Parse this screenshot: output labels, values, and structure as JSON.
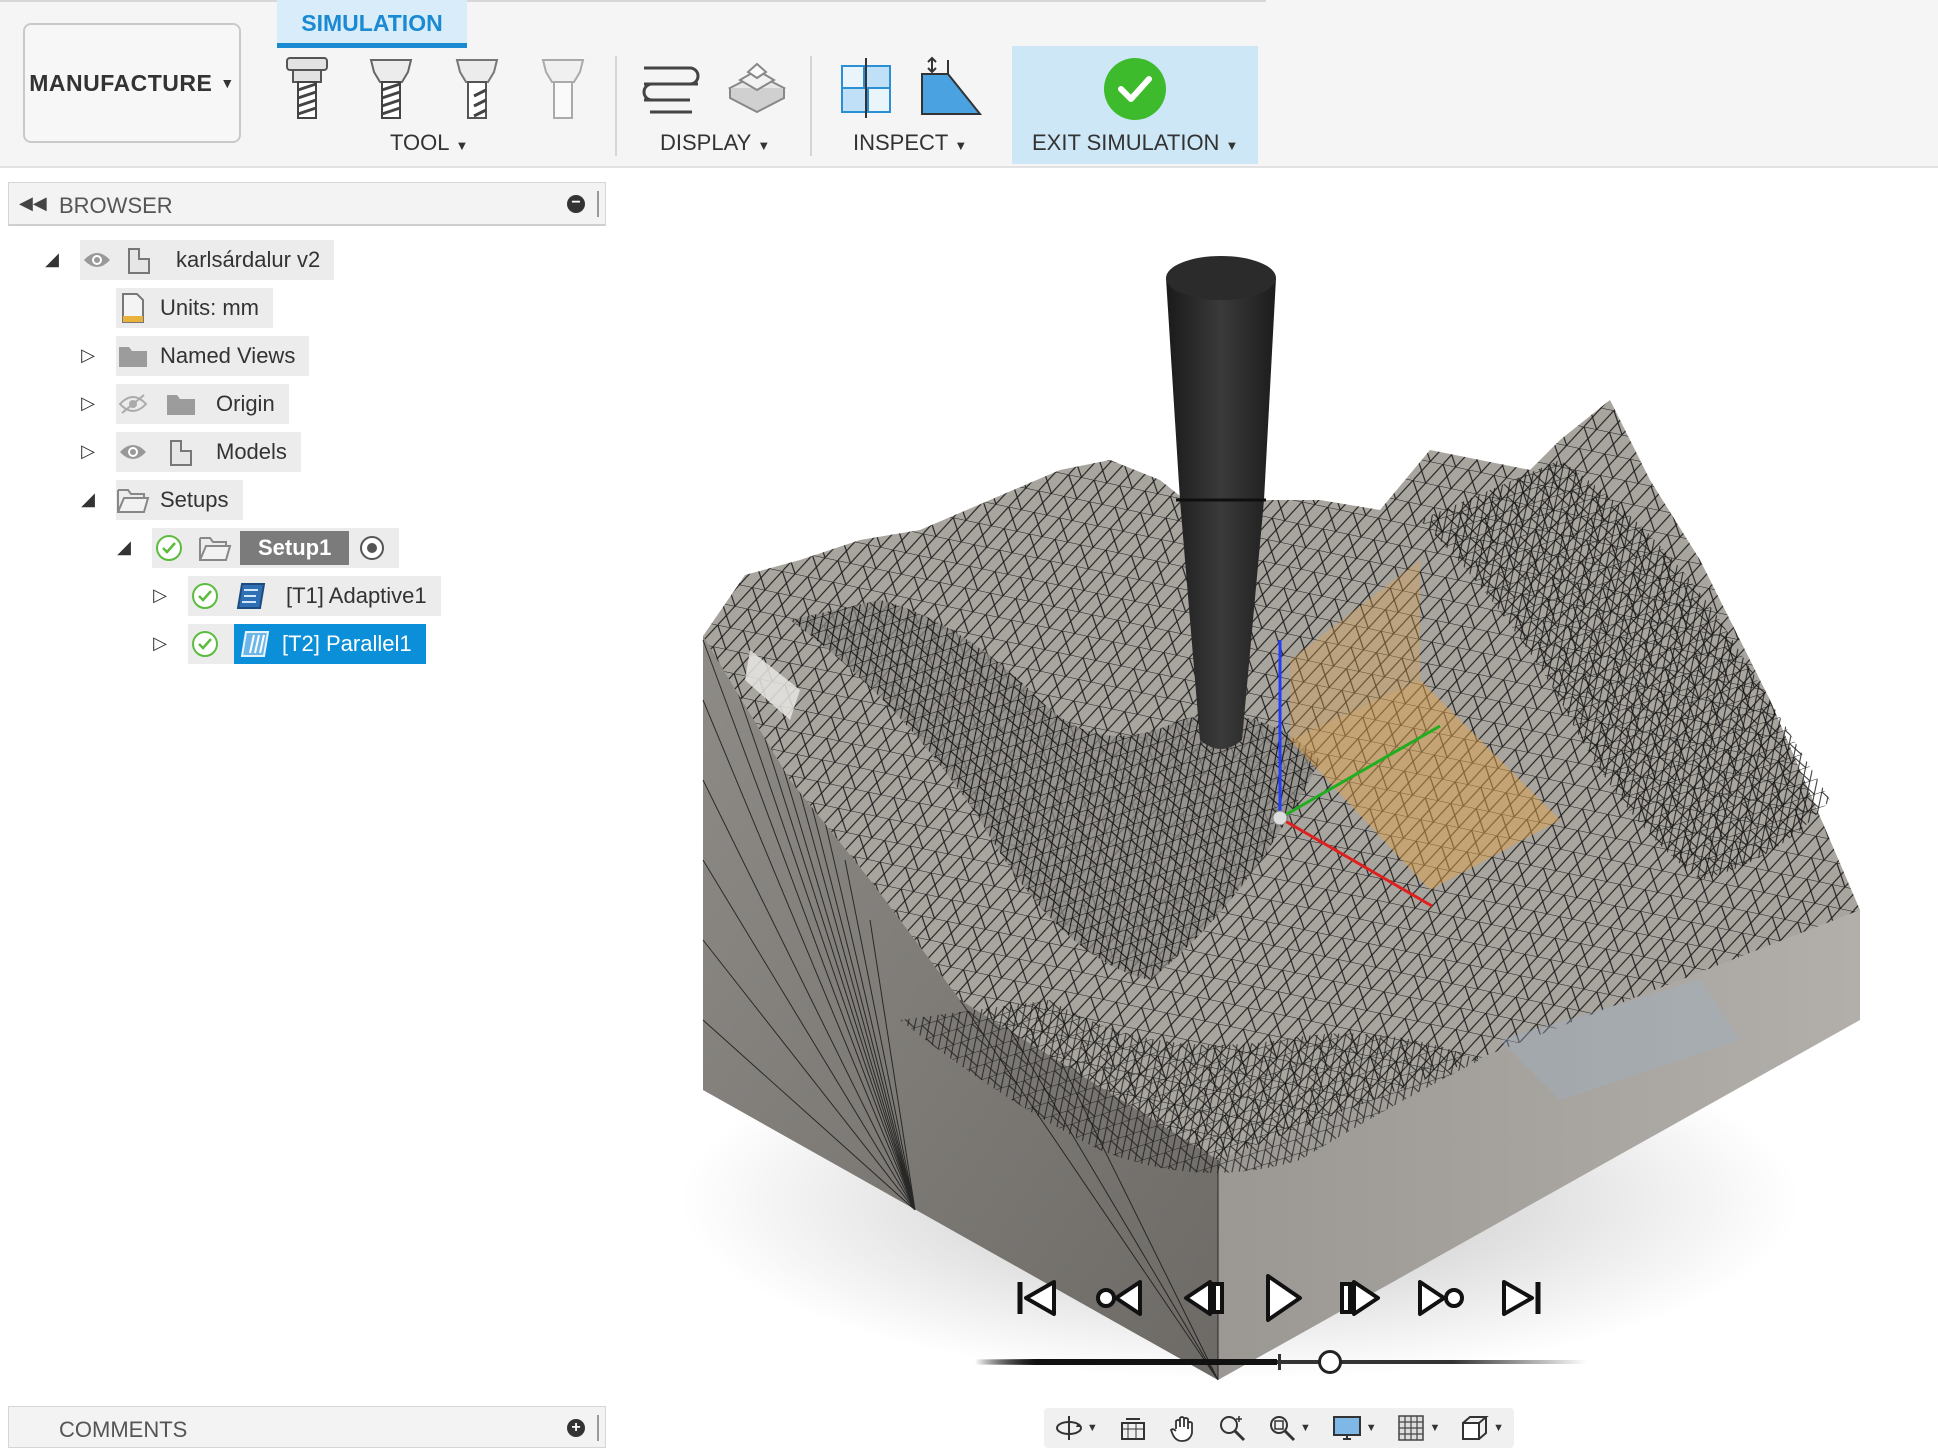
{
  "toolbar": {
    "workspace_label": "MANUFACTURE",
    "active_tab": "SIMULATION",
    "groups": {
      "tool": "TOOL",
      "display": "DISPLAY",
      "inspect": "INSPECT",
      "exit": "EXIT SIMULATION"
    },
    "colors": {
      "accent": "#1a8ad3",
      "exit_bg": "#cde7f6",
      "check": "#3dbb2c"
    }
  },
  "browser": {
    "title": "BROWSER",
    "tree": {
      "root": "karlsárdalur v2",
      "units": "Units: mm",
      "named_views": "Named Views",
      "origin": "Origin",
      "models": "Models",
      "setups": "Setups",
      "setup1": "Setup1",
      "op1": "[T1] Adaptive1",
      "op2": "[T2] Parallel1"
    },
    "selected_item": "[T2] Parallel1",
    "selection_color": "#0b8fd8"
  },
  "comments": {
    "title": "COMMENTS"
  },
  "playback": {
    "buttons": [
      "skip-to-start",
      "previous-operation",
      "step-back",
      "play",
      "step-forward",
      "next-operation",
      "skip-to-end"
    ],
    "progress": 0.6
  },
  "nav_bar": {
    "items": [
      "orbit-icon",
      "look-at-icon",
      "pan-icon",
      "zoom-icon",
      "fit-icon",
      "display-settings-icon",
      "grid-icon",
      "viewports-icon"
    ]
  }
}
